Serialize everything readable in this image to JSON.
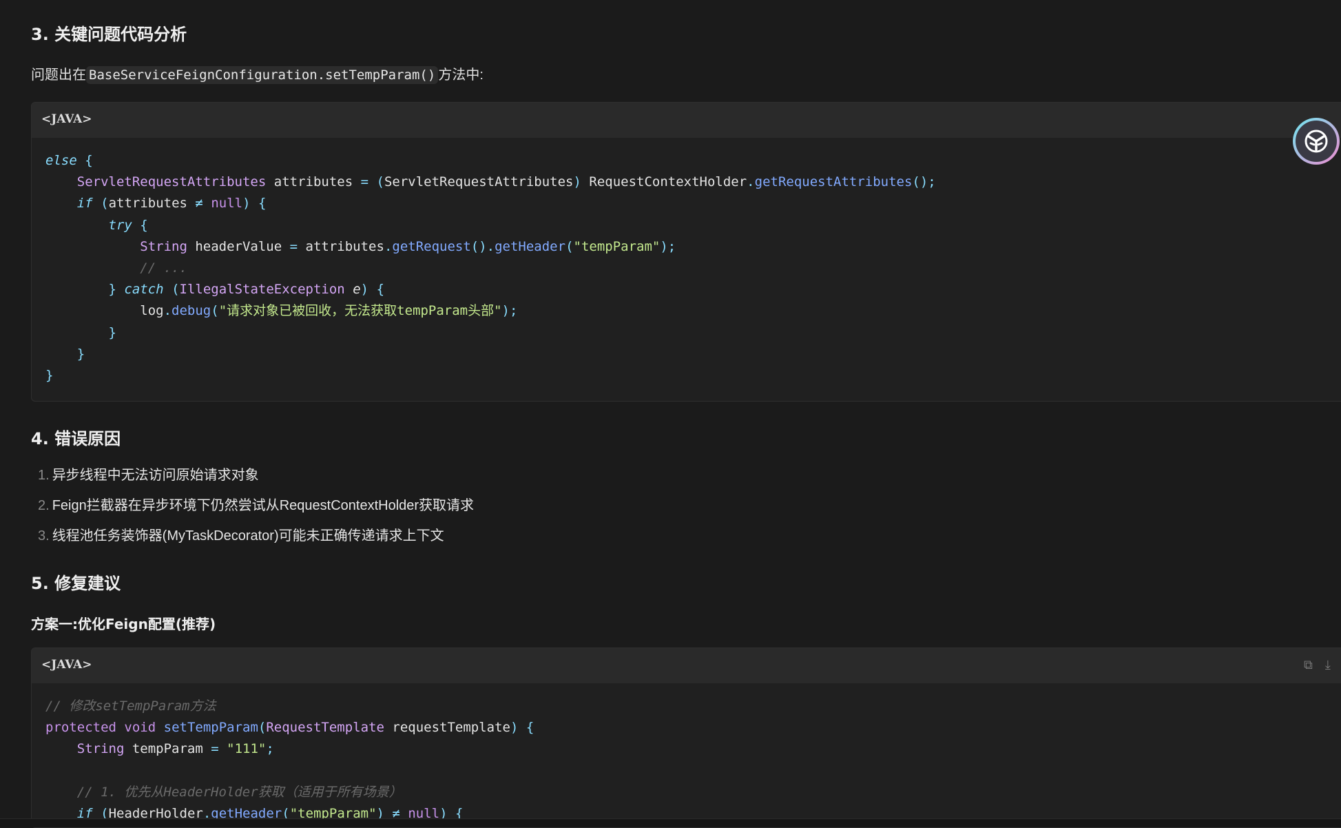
{
  "sections": {
    "s3": {
      "title": "3. 关键问题代码分析"
    },
    "s4": {
      "title": "4. 错误原因"
    },
    "s5": {
      "title": "5. 修复建议"
    }
  },
  "intro": {
    "prefix": "问题出在",
    "code": "BaseServiceFeignConfiguration.setTempParam()",
    "suffix": "方法中:"
  },
  "codeblock1": {
    "lang": "<JAVA>"
  },
  "codeblock2": {
    "lang": "<JAVA>"
  },
  "causes": [
    {
      "num": "1.",
      "text": "异步线程中无法访问原始请求对象"
    },
    {
      "num": "2.",
      "text": "Feign拦截器在异步环境下仍然尝试从RequestContextHolder获取请求"
    },
    {
      "num": "3.",
      "text": "线程池任务装饰器(MyTaskDecorator)可能未正确传递请求上下文"
    }
  ],
  "plan1": {
    "title": "方案一:优化Feign配置(推荐)"
  },
  "icons": {
    "copy": "copy-icon",
    "download": "download-icon",
    "assistant": "assistant-logo-icon"
  }
}
